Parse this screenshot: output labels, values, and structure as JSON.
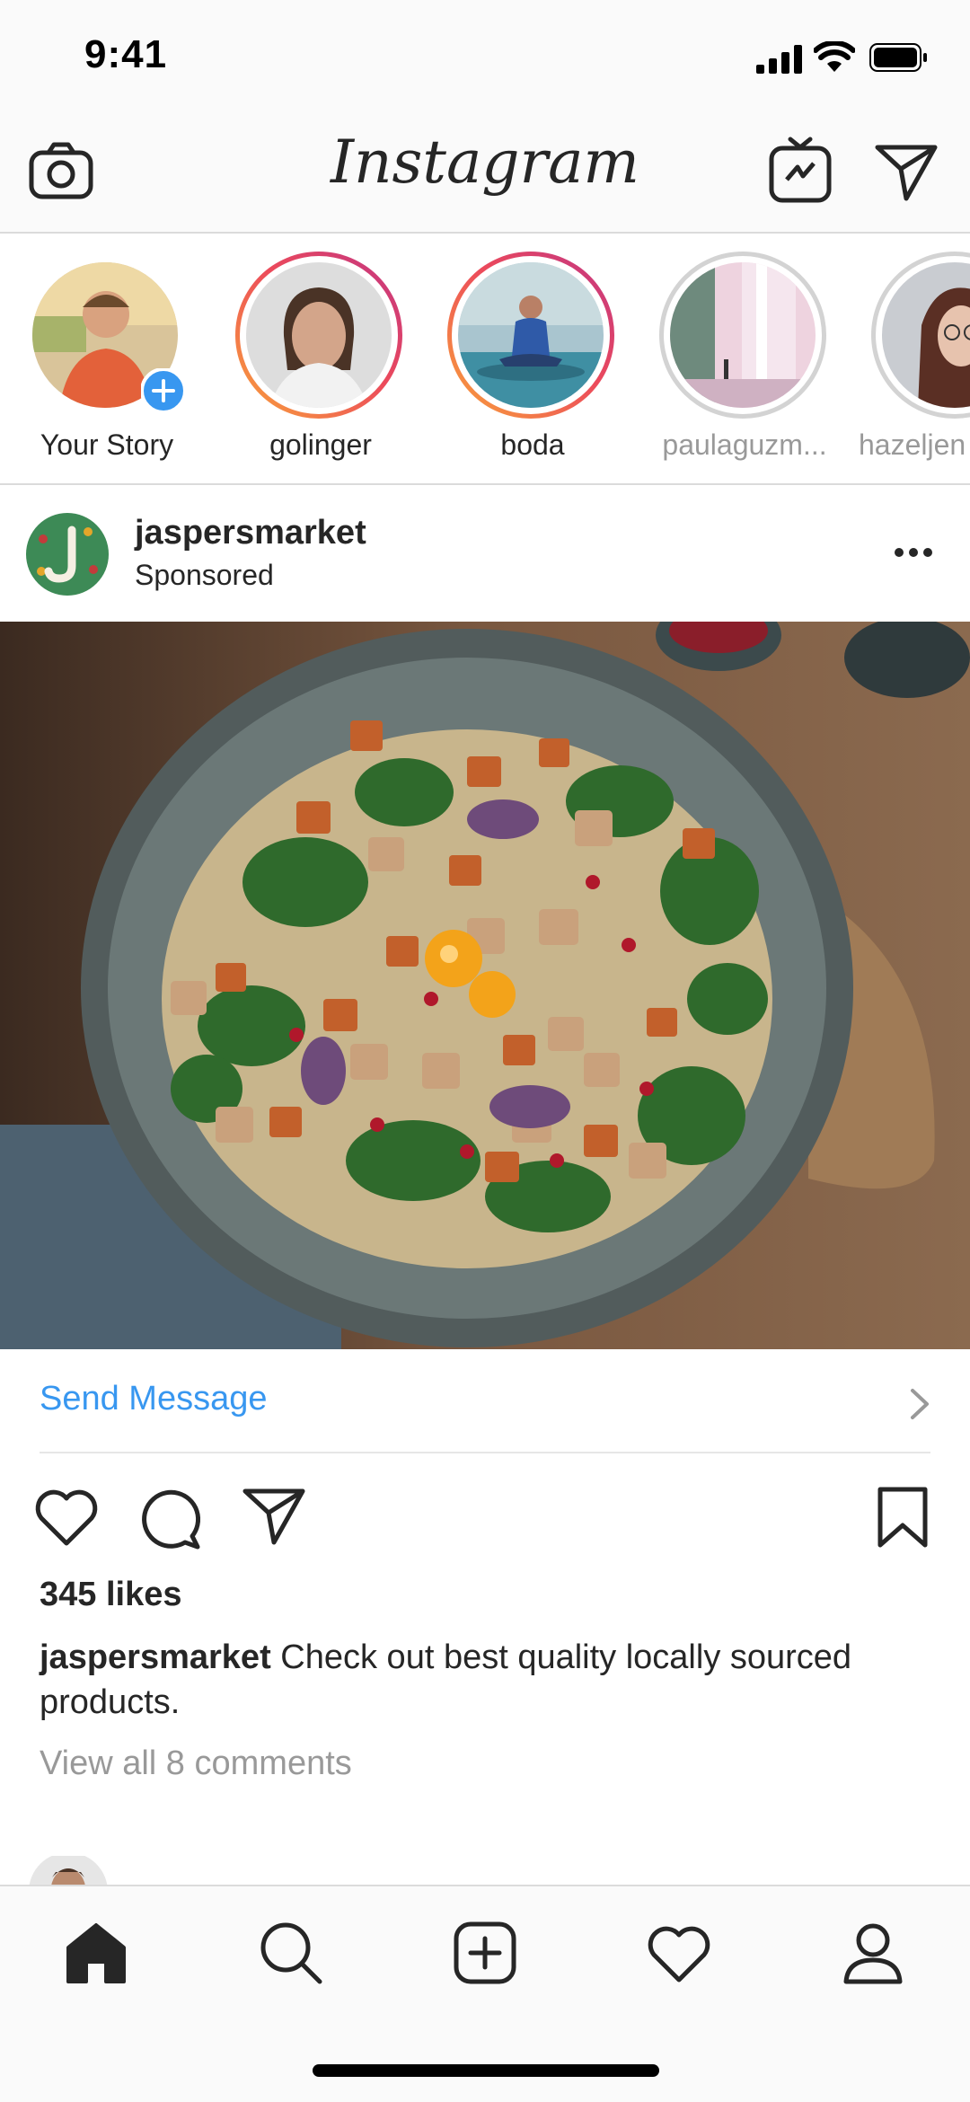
{
  "status_bar": {
    "time": "9:41"
  },
  "header": {
    "logo_text": "Instagram",
    "icons": [
      "camera-icon",
      "igtv-icon",
      "direct-message-icon"
    ]
  },
  "stories": [
    {
      "name": "Your Story",
      "state": "own"
    },
    {
      "name": "golinger",
      "state": "unseen"
    },
    {
      "name": "boda",
      "state": "unseen"
    },
    {
      "name": "paulaguzm...",
      "state": "seen"
    },
    {
      "name": "hazeljen",
      "state": "seen"
    }
  ],
  "post": {
    "username": "jaspersmarket",
    "subtitle": "Sponsored",
    "cta_label": "Send Message",
    "likes": "345 likes",
    "caption_user": "jaspersmarket",
    "caption_text": " Check out best quality locally sourced products.",
    "comments_link": "View all 8 comments"
  },
  "colors": {
    "link_blue": "#3897f0",
    "story_gradient": [
      "#f9a43a",
      "#ec4a5b",
      "#c13584"
    ],
    "seen_ring": "#d3d3d3"
  },
  "bottom_nav": [
    "home-icon",
    "search-icon",
    "new-post-icon",
    "activity-heart-icon",
    "profile-icon"
  ]
}
